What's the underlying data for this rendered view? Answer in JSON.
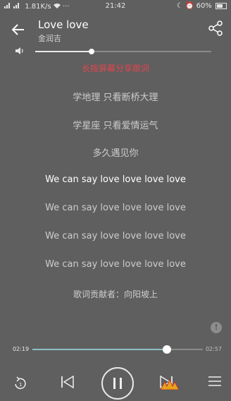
{
  "status_bar": {
    "signal": "ⵑill ⵑill",
    "speed": "1.81K/s",
    "icons": "wifi-icon ···",
    "time": "21:42",
    "battery": "60%",
    "alarm_icons": "moon alarm"
  },
  "header": {
    "title": "Love love",
    "artist": "金润吉"
  },
  "volume": {
    "level": 0.32
  },
  "hint": "长按屏幕分享歌词",
  "lyrics": [
    "学地理 只看断桥大理",
    "学星座 只看爱情运气",
    "多久遇见你",
    "We can say love love love love",
    "We can say love love love love",
    "We can say love love love love",
    "We can say love love love love",
    "歌词贡献者：向阳坡上"
  ],
  "current_lyric_index": 3,
  "info_label": "!",
  "progress": {
    "elapsed": "02:19",
    "total": "02:57",
    "fraction": 0.79
  },
  "accent": "#e0464d"
}
